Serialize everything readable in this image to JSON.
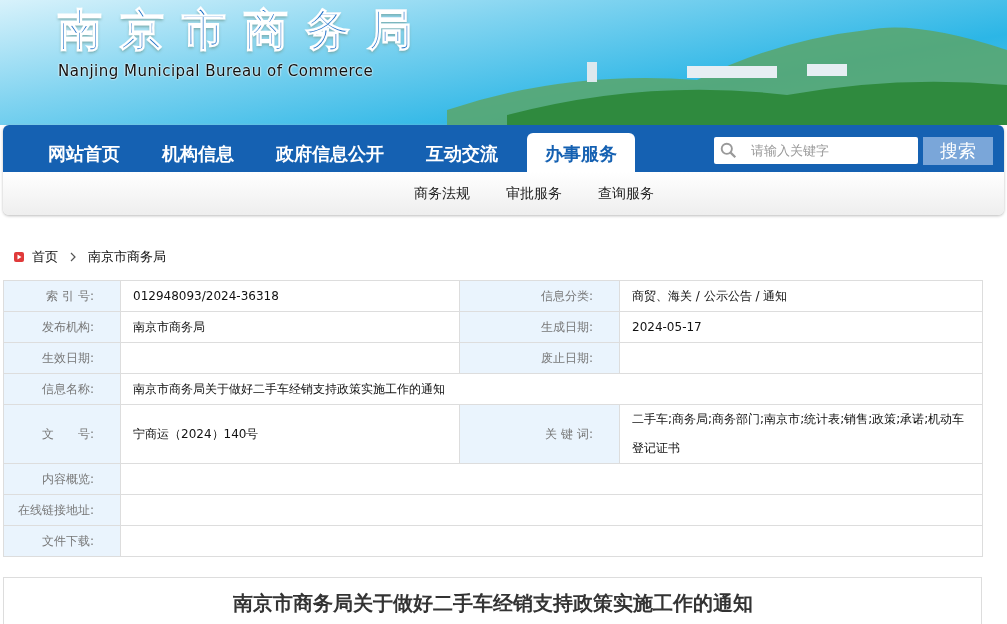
{
  "header": {
    "title": "南京市商务局",
    "subtitle": "Nanjing Municipal Bureau of Commerce"
  },
  "nav": {
    "items": [
      {
        "label": "网站首页",
        "selected": false
      },
      {
        "label": "机构信息",
        "selected": false
      },
      {
        "label": "政府信息公开",
        "selected": false
      },
      {
        "label": "互动交流",
        "selected": false
      },
      {
        "label": "办事服务",
        "selected": true
      }
    ],
    "search": {
      "placeholder": "请输入关键字",
      "button": "搜索"
    }
  },
  "subnav": {
    "items": [
      "商务法规",
      "审批服务",
      "查询服务"
    ]
  },
  "breadcrumb": [
    "首页",
    "南京市商务局"
  ],
  "info_table": {
    "rows": [
      {
        "cells": [
          {
            "label": "索 引 号:",
            "value": "012948093/2024-36318"
          },
          {
            "label": "信息分类:",
            "value": "商贸、海关 / 公示公告 / 通知"
          }
        ]
      },
      {
        "cells": [
          {
            "label": "发布机构:",
            "value": "南京市商务局"
          },
          {
            "label": "生成日期:",
            "value": "2024-05-17"
          }
        ]
      },
      {
        "cells": [
          {
            "label": "生效日期:"
          },
          {
            "label": "废止日期:"
          }
        ]
      },
      {
        "cells": [
          {
            "label": "信息名称:",
            "value": "南京市商务局关于做好二手车经销支持政策实施工作的通知"
          }
        ]
      },
      {
        "cells": [
          {
            "label": "文　　号:",
            "value": "宁商运（2024）140号"
          },
          {
            "label": "关 键 词:",
            "value": "二手车;商务局;商务部门;南京市;统计表;销售;政策;承诺;机动车登记证书"
          }
        ]
      },
      {
        "cells": [
          {
            "label": "内容概览:"
          }
        ]
      },
      {
        "cells": [
          {
            "label": "在线链接地址:"
          }
        ]
      },
      {
        "cells": [
          {
            "label": "文件下载:"
          }
        ]
      }
    ]
  },
  "article": {
    "title": "南京市商务局关于做好二手车经销支持政策实施工作的通知"
  }
}
